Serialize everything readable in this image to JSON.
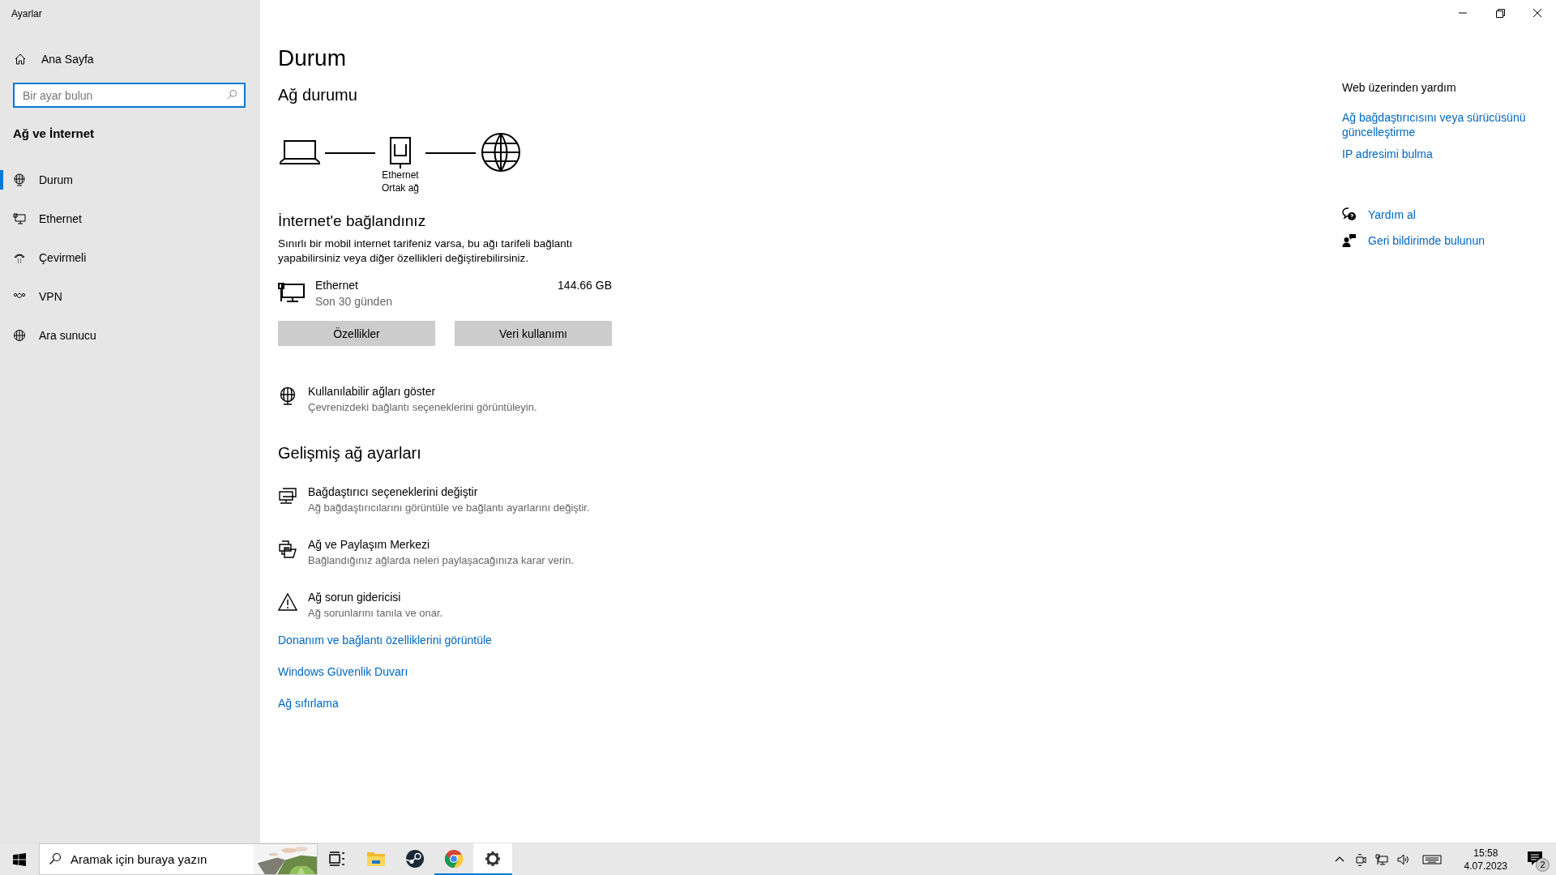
{
  "window": {
    "title": "Ayarlar"
  },
  "sidebar": {
    "home": "Ana Sayfa",
    "search": {
      "placeholder": "Bir ayar bulun"
    },
    "section": "Ağ ve İnternet",
    "items": [
      {
        "kind": "status",
        "label": "Durum",
        "selected": true
      },
      {
        "kind": "ethernet",
        "label": "Ethernet",
        "selected": false
      },
      {
        "kind": "dialup",
        "label": "Çevirmeli",
        "selected": false
      },
      {
        "kind": "vpn",
        "label": "VPN",
        "selected": false
      },
      {
        "kind": "proxy",
        "label": "Ara sunucu",
        "selected": false
      }
    ]
  },
  "page": {
    "title": "Durum",
    "network_status": {
      "heading": "Ağ durumu",
      "adapter_label": "Ethernet",
      "network_label": "Ortak ağ"
    },
    "connection": {
      "heading": "İnternet'e bağlandınız",
      "description": "Sınırlı bir mobil internet tarifeniz varsa, bu ağı tarifeli bağlantı yapabilirsiniz veya diğer özellikleri değiştirebilirsiniz.",
      "adapter": {
        "name": "Ethernet",
        "period": "Son 30 günden",
        "usage": "144.66 GB"
      },
      "buttons": [
        "Özellikler",
        "Veri kullanımı"
      ]
    },
    "show_networks": {
      "title": "Kullanılabilir ağları göster",
      "description": "Çevrenizdeki bağlantı seçeneklerini görüntüleyin."
    },
    "advanced": {
      "heading": "Gelişmiş ağ ayarları",
      "items": [
        {
          "kind": "adapter",
          "title": "Bağdaştırıcı seçeneklerini değiştir",
          "description": "Ağ bağdaştırıcılarını görüntüle ve bağlantı ayarlarını değiştir."
        },
        {
          "kind": "sharing",
          "title": "Ağ ve Paylaşım Merkezi",
          "description": "Bağlandığınız ağlarda neleri paylaşacağınıza karar verin."
        },
        {
          "kind": "troubleshoot",
          "title": "Ağ sorun gidericisi",
          "description": "Ağ sorunlarını tanıla ve onar."
        }
      ],
      "links": [
        "Donanım ve bağlantı özelliklerini görüntüle",
        "Windows Güvenlik Duvarı",
        "Ağ sıfırlama"
      ]
    }
  },
  "help": {
    "heading": "Web üzerinden yardım",
    "links": [
      "Ağ bağdaştırıcısını veya sürücüsünü güncelleştirme",
      "IP adresimi bulma"
    ],
    "actions": [
      {
        "kind": "help",
        "label": "Yardım al"
      },
      {
        "kind": "feedback",
        "label": "Geri bildirimde bulunun"
      }
    ]
  },
  "taskbar": {
    "search": {
      "placeholder": "Aramak için buraya yazın"
    },
    "apps": [
      {
        "kind": "taskview",
        "running": false,
        "selected": false
      },
      {
        "kind": "explorer",
        "running": false,
        "selected": false
      },
      {
        "kind": "steam",
        "running": false,
        "selected": false
      },
      {
        "kind": "chrome",
        "running": true,
        "selected": false
      },
      {
        "kind": "settings",
        "running": true,
        "selected": true
      }
    ],
    "clock": {
      "time": "15:58",
      "date": "4.07.2023"
    },
    "notification_count": "2"
  }
}
